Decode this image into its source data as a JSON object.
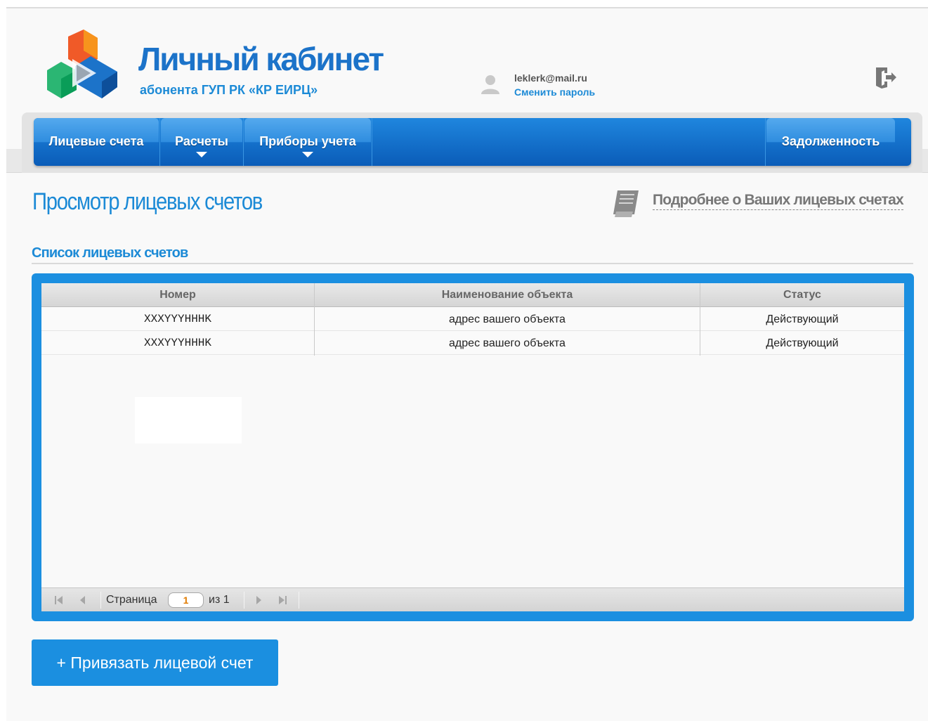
{
  "header": {
    "title": "Личный кабинет",
    "subtitle": "абонента ГУП РК «КР ЕИРЦ»",
    "user_email": "leklerk@mail.ru",
    "change_password": "Сменить пароль"
  },
  "nav": {
    "items": [
      {
        "label": "Лицевые счета"
      },
      {
        "label": "Расчеты"
      },
      {
        "label": "Приборы учета"
      },
      {
        "label": "Задолженность"
      }
    ]
  },
  "page": {
    "title": "Просмотр лицевых счетов",
    "more_link": "Подробнее о Ваших лицевых счетах",
    "section_title": "Список лицевых счетов"
  },
  "table": {
    "columns": [
      "Номер",
      "Наименование объекта",
      "Статус"
    ],
    "rows": [
      {
        "number": "XXXYYYHHHK",
        "object": "адрес вашего объекта",
        "status": "Действующий"
      },
      {
        "number": "XXXYYYHHHK",
        "object": "адрес вашего объекта",
        "status": "Действующий"
      }
    ]
  },
  "pager": {
    "page_label": "Страница",
    "current_page": "1",
    "of_label": "из 1"
  },
  "actions": {
    "bind_account": "+ Привязать лицевой счет"
  },
  "colors": {
    "accent": "#1b8fe0",
    "nav_top": "#1f86de",
    "nav_bottom": "#0a5cb8",
    "title_blue": "#1c8ad6",
    "pager_value": "#e07b00"
  }
}
